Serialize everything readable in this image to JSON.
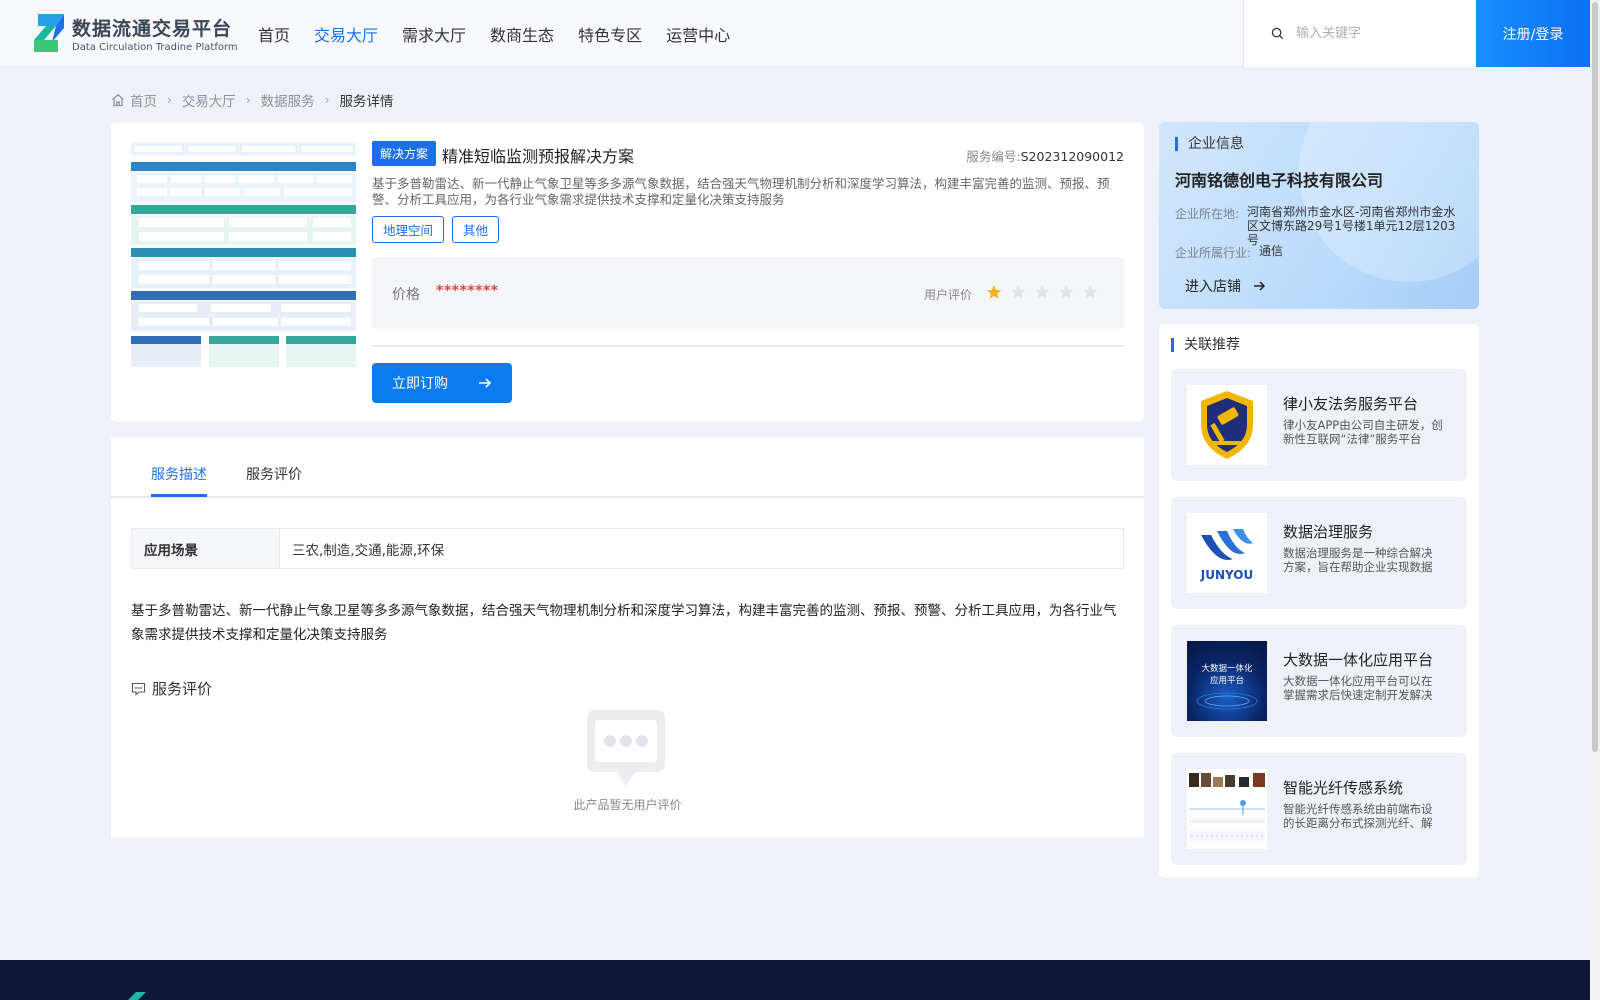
{
  "header": {
    "logo_cn": "数据流通交易平台",
    "logo_en": "Data Circulation Tradine Platform",
    "nav": [
      "首页",
      "交易大厅",
      "需求大厅",
      "数商生态",
      "特色专区",
      "运营中心"
    ],
    "active_nav": "交易大厅",
    "search_placeholder": "输入关键字",
    "login_label": "注册/登录"
  },
  "breadcrumb": [
    "首页",
    "交易大厅",
    "数据服务",
    "服务详情"
  ],
  "product": {
    "badge": "解决方案",
    "title": "精准短临监测预报解决方案",
    "service_no_label": "服务编号:",
    "service_no": "S202312090012",
    "description": "基于多普勒雷达、新一代静止气象卫星等多多源气象数据，结合强天气物理机制分析和深度学习算法，构建丰富完善的监测、预报、预警、分析工具应用，为各行业气象需求提供技术支撑和定量化决策支持服务",
    "tags": [
      "地理空间",
      "其他"
    ],
    "price_label": "价格",
    "price_value": "********",
    "rating_label": "用户评价",
    "rating": 1,
    "rating_max": 5,
    "buy_label": "立即订购"
  },
  "tabs": {
    "items": [
      "服务描述",
      "服务评价"
    ],
    "active": "服务描述"
  },
  "detail": {
    "scene_label": "应用场景",
    "scene_value": "三农,制造,交通,能源,环保",
    "text": "基于多普勒雷达、新一代静止气象卫星等多多源气象数据，结合强天气物理机制分析和深度学习算法，构建丰富完善的监测、预报、预警、分析工具应用，为各行业气象需求提供技术支撑和定量化决策支持服务",
    "review_title": "服务评价",
    "empty_text": "此产品暂无用户评价"
  },
  "company": {
    "section_title": "企业信息",
    "name": "河南铭德创电子科技有限公司",
    "location_label": "企业所在地:",
    "location": "河南省郑州市金水区-河南省郑州市金水区文博东路29号1号楼1单元12层1203号",
    "industry_label": "企业所属行业:",
    "industry": "通信",
    "shop_link": "进入店铺"
  },
  "recommend": {
    "section_title": "关联推荐",
    "items": [
      {
        "title": "律小友法务服务平台",
        "desc": "律小友APP由公司自主研发，创新性互联网“法律”服务平台"
      },
      {
        "title": "数据治理服务",
        "desc": "数据治理服务是一种综合解决方案，旨在帮助企业实现数据治理"
      },
      {
        "title": "大数据一体化应用平台",
        "desc": "大数据一体化应用平台可以在掌握需求后快速定制开发解决方案"
      },
      {
        "title": "智能光纤传感系统",
        "desc": "智能光纤传感系统由前端布设的长距离分布式探测光纤、解调设备组成"
      }
    ]
  },
  "thumb_texts": {
    "rec2_logo": "JUNYOU",
    "rec3_line1": "大数据一体化",
    "rec3_line2": "应用平台"
  },
  "colors": {
    "primary": "#1d6fe8",
    "price": "#e0463a",
    "star_on": "#f6b01e",
    "star_off": "#e1e4ea",
    "footer": "#0e1733"
  }
}
